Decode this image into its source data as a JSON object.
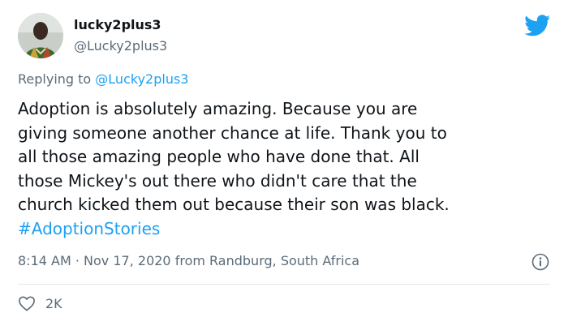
{
  "user": {
    "display_name": "lucky2plus3",
    "handle": "@Lucky2plus3"
  },
  "reply": {
    "prefix": "Replying to",
    "to": "@Lucky2plus3"
  },
  "tweet": {
    "lines": [
      "Adoption is absolutely amazing. Because you are",
      "giving someone another chance at life. Thank you to",
      "all those amazing people who have done that. All",
      "those Mickey's out there who didn't care that the",
      "church kicked them out because their son was black."
    ],
    "hashtag": "#AdoptionStories"
  },
  "meta": {
    "time": "8:14 AM",
    "separator": "·",
    "date": "Nov 17, 2020",
    "location": "from Randburg, South Africa"
  },
  "stats": {
    "likes": "2K"
  },
  "icons": {
    "brand": "twitter-bird-icon",
    "info": "info-icon",
    "like": "heart-icon"
  },
  "colors": {
    "accent": "#1da1f2",
    "text": "#0f1419",
    "secondary": "#5b6b78",
    "divider": "#e1e8ed"
  }
}
